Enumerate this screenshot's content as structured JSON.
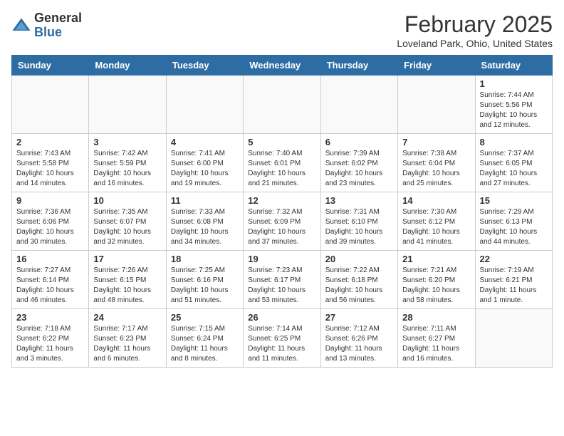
{
  "header": {
    "logo_general": "General",
    "logo_blue": "Blue",
    "month": "February 2025",
    "location": "Loveland Park, Ohio, United States"
  },
  "weekdays": [
    "Sunday",
    "Monday",
    "Tuesday",
    "Wednesday",
    "Thursday",
    "Friday",
    "Saturday"
  ],
  "weeks": [
    [
      {
        "day": "",
        "info": ""
      },
      {
        "day": "",
        "info": ""
      },
      {
        "day": "",
        "info": ""
      },
      {
        "day": "",
        "info": ""
      },
      {
        "day": "",
        "info": ""
      },
      {
        "day": "",
        "info": ""
      },
      {
        "day": "1",
        "info": "Sunrise: 7:44 AM\nSunset: 5:56 PM\nDaylight: 10 hours\nand 12 minutes."
      }
    ],
    [
      {
        "day": "2",
        "info": "Sunrise: 7:43 AM\nSunset: 5:58 PM\nDaylight: 10 hours\nand 14 minutes."
      },
      {
        "day": "3",
        "info": "Sunrise: 7:42 AM\nSunset: 5:59 PM\nDaylight: 10 hours\nand 16 minutes."
      },
      {
        "day": "4",
        "info": "Sunrise: 7:41 AM\nSunset: 6:00 PM\nDaylight: 10 hours\nand 19 minutes."
      },
      {
        "day": "5",
        "info": "Sunrise: 7:40 AM\nSunset: 6:01 PM\nDaylight: 10 hours\nand 21 minutes."
      },
      {
        "day": "6",
        "info": "Sunrise: 7:39 AM\nSunset: 6:02 PM\nDaylight: 10 hours\nand 23 minutes."
      },
      {
        "day": "7",
        "info": "Sunrise: 7:38 AM\nSunset: 6:04 PM\nDaylight: 10 hours\nand 25 minutes."
      },
      {
        "day": "8",
        "info": "Sunrise: 7:37 AM\nSunset: 6:05 PM\nDaylight: 10 hours\nand 27 minutes."
      }
    ],
    [
      {
        "day": "9",
        "info": "Sunrise: 7:36 AM\nSunset: 6:06 PM\nDaylight: 10 hours\nand 30 minutes."
      },
      {
        "day": "10",
        "info": "Sunrise: 7:35 AM\nSunset: 6:07 PM\nDaylight: 10 hours\nand 32 minutes."
      },
      {
        "day": "11",
        "info": "Sunrise: 7:33 AM\nSunset: 6:08 PM\nDaylight: 10 hours\nand 34 minutes."
      },
      {
        "day": "12",
        "info": "Sunrise: 7:32 AM\nSunset: 6:09 PM\nDaylight: 10 hours\nand 37 minutes."
      },
      {
        "day": "13",
        "info": "Sunrise: 7:31 AM\nSunset: 6:10 PM\nDaylight: 10 hours\nand 39 minutes."
      },
      {
        "day": "14",
        "info": "Sunrise: 7:30 AM\nSunset: 6:12 PM\nDaylight: 10 hours\nand 41 minutes."
      },
      {
        "day": "15",
        "info": "Sunrise: 7:29 AM\nSunset: 6:13 PM\nDaylight: 10 hours\nand 44 minutes."
      }
    ],
    [
      {
        "day": "16",
        "info": "Sunrise: 7:27 AM\nSunset: 6:14 PM\nDaylight: 10 hours\nand 46 minutes."
      },
      {
        "day": "17",
        "info": "Sunrise: 7:26 AM\nSunset: 6:15 PM\nDaylight: 10 hours\nand 48 minutes."
      },
      {
        "day": "18",
        "info": "Sunrise: 7:25 AM\nSunset: 6:16 PM\nDaylight: 10 hours\nand 51 minutes."
      },
      {
        "day": "19",
        "info": "Sunrise: 7:23 AM\nSunset: 6:17 PM\nDaylight: 10 hours\nand 53 minutes."
      },
      {
        "day": "20",
        "info": "Sunrise: 7:22 AM\nSunset: 6:18 PM\nDaylight: 10 hours\nand 56 minutes."
      },
      {
        "day": "21",
        "info": "Sunrise: 7:21 AM\nSunset: 6:20 PM\nDaylight: 10 hours\nand 58 minutes."
      },
      {
        "day": "22",
        "info": "Sunrise: 7:19 AM\nSunset: 6:21 PM\nDaylight: 11 hours\nand 1 minute."
      }
    ],
    [
      {
        "day": "23",
        "info": "Sunrise: 7:18 AM\nSunset: 6:22 PM\nDaylight: 11 hours\nand 3 minutes."
      },
      {
        "day": "24",
        "info": "Sunrise: 7:17 AM\nSunset: 6:23 PM\nDaylight: 11 hours\nand 6 minutes."
      },
      {
        "day": "25",
        "info": "Sunrise: 7:15 AM\nSunset: 6:24 PM\nDaylight: 11 hours\nand 8 minutes."
      },
      {
        "day": "26",
        "info": "Sunrise: 7:14 AM\nSunset: 6:25 PM\nDaylight: 11 hours\nand 11 minutes."
      },
      {
        "day": "27",
        "info": "Sunrise: 7:12 AM\nSunset: 6:26 PM\nDaylight: 11 hours\nand 13 minutes."
      },
      {
        "day": "28",
        "info": "Sunrise: 7:11 AM\nSunset: 6:27 PM\nDaylight: 11 hours\nand 16 minutes."
      },
      {
        "day": "",
        "info": ""
      }
    ]
  ]
}
